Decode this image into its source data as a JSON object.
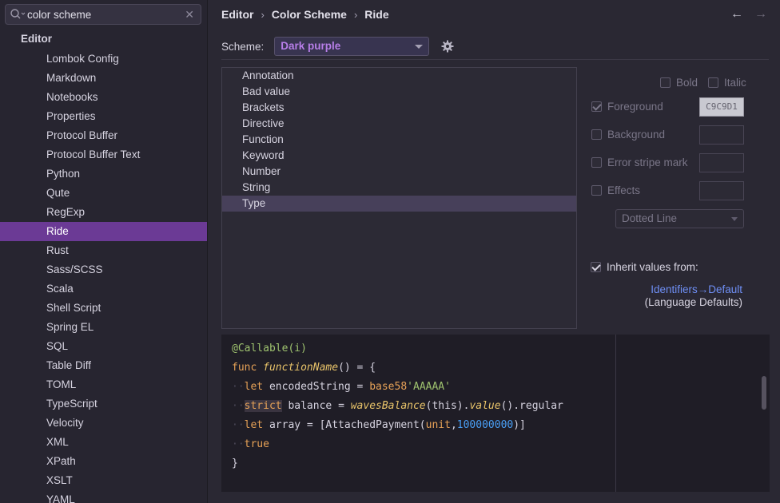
{
  "search": {
    "value": "color scheme"
  },
  "sidebar": {
    "root": "Editor",
    "items": [
      "Lombok Config",
      "Markdown",
      "Notebooks",
      "Properties",
      "Protocol Buffer",
      "Protocol Buffer Text",
      "Python",
      "Qute",
      "RegExp",
      "Ride",
      "Rust",
      "Sass/SCSS",
      "Scala",
      "Shell Script",
      "Spring EL",
      "SQL",
      "Table Diff",
      "TOML",
      "TypeScript",
      "Velocity",
      "XML",
      "XPath",
      "XSLT",
      "YAML"
    ],
    "selected": "Ride"
  },
  "breadcrumb": [
    "Editor",
    "Color Scheme",
    "Ride"
  ],
  "scheme": {
    "label": "Scheme:",
    "value": "Dark purple"
  },
  "attributes": {
    "items": [
      "Annotation",
      "Bad value",
      "Brackets",
      "Directive",
      "Function",
      "Keyword",
      "Number",
      "String",
      "Type"
    ],
    "selected": "Type"
  },
  "options": {
    "bold": "Bold",
    "italic": "Italic",
    "foreground": "Foreground",
    "foreground_color": "C9C9D1",
    "background": "Background",
    "error_stripe": "Error stripe mark",
    "effects": "Effects",
    "effect_type": "Dotted Line",
    "inherit": "Inherit values from:",
    "inherit_link": "Identifiers→Default",
    "inherit_sub": "(Language Defaults)"
  },
  "preview": {
    "annotation": "@Callable(i)",
    "func_kw": "func",
    "func_name": "functionName",
    "func_rest": "() = {",
    "let1": "let",
    "var1": " encodedString = ",
    "base58": "base58",
    "str1": "'AAAAA'",
    "strict": "strict",
    "balance": " balance = ",
    "waves_balance": "wavesBalance",
    "this_part": "(this).",
    "value_fn": "value",
    "regular": "().regular",
    "let2": "let",
    "array_part": " array = [AttachedPayment(",
    "unit": "unit",
    "comma": ",",
    "num": "100000000",
    "close_br": ")]",
    "true_kw": "true",
    "close": "}"
  },
  "colors": {
    "selection": "#6b3a95",
    "link": "#6f8ff5",
    "accent_text": "#b77ee8"
  }
}
